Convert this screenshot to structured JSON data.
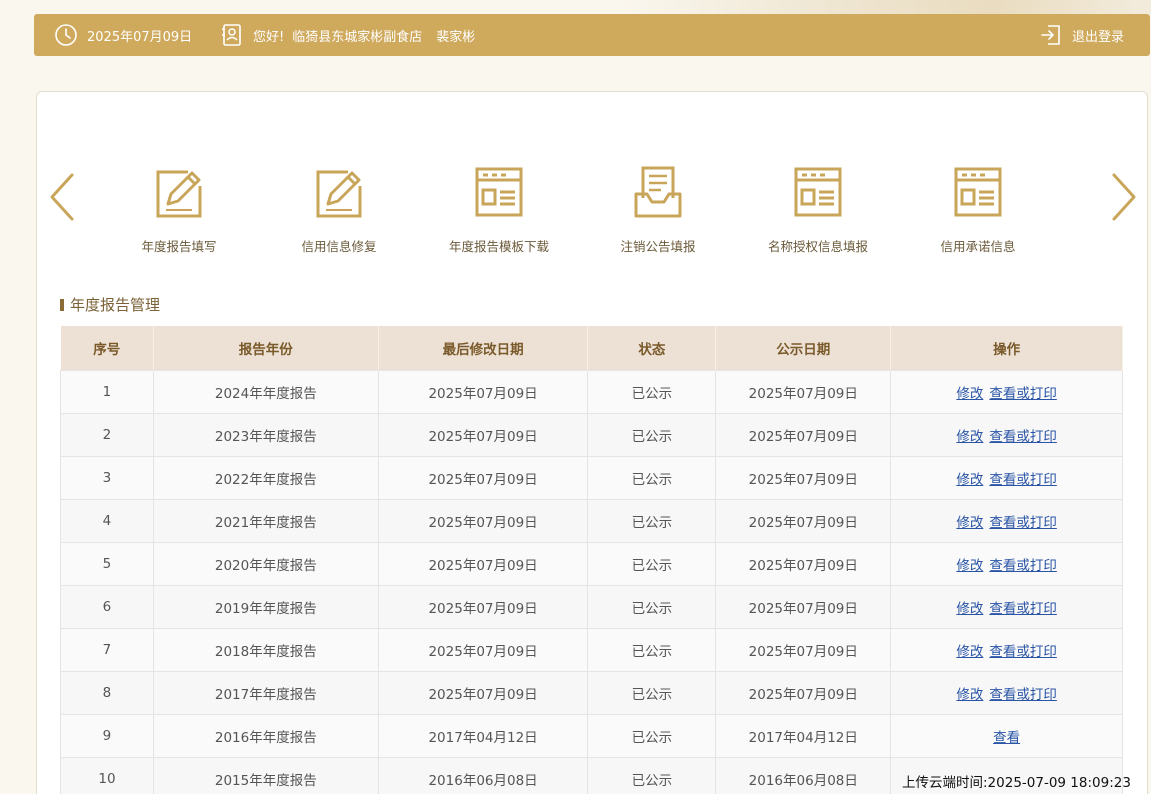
{
  "header": {
    "date": "2025年07月09日",
    "greeting": "您好!",
    "store_name": "临猗县东城家彬副食店",
    "user_name": "裴家彬",
    "logout_label": "退出登录"
  },
  "shortcuts": [
    {
      "label": "年度报告填写",
      "icon": "edit-form-icon"
    },
    {
      "label": "信用信息修复",
      "icon": "edit-form-icon"
    },
    {
      "label": "年度报告模板下载",
      "icon": "template-window-icon"
    },
    {
      "label": "注销公告填报",
      "icon": "inbox-document-icon"
    },
    {
      "label": "名称授权信息填报",
      "icon": "template-window-icon"
    },
    {
      "label": "信用承诺信息",
      "icon": "template-window-icon"
    }
  ],
  "section_title": "年度报告管理",
  "table": {
    "headers": [
      "序号",
      "报告年份",
      "最后修改日期",
      "状态",
      "公示日期",
      "操作"
    ],
    "rows": [
      {
        "no": "1",
        "year": "2024年年度报告",
        "modified": "2025年07月09日",
        "status": "已公示",
        "published": "2025年07月09日",
        "ops": [
          "修改",
          "查看或打印"
        ]
      },
      {
        "no": "2",
        "year": "2023年年度报告",
        "modified": "2025年07月09日",
        "status": "已公示",
        "published": "2025年07月09日",
        "ops": [
          "修改",
          "查看或打印"
        ]
      },
      {
        "no": "3",
        "year": "2022年年度报告",
        "modified": "2025年07月09日",
        "status": "已公示",
        "published": "2025年07月09日",
        "ops": [
          "修改",
          "查看或打印"
        ]
      },
      {
        "no": "4",
        "year": "2021年年度报告",
        "modified": "2025年07月09日",
        "status": "已公示",
        "published": "2025年07月09日",
        "ops": [
          "修改",
          "查看或打印"
        ]
      },
      {
        "no": "5",
        "year": "2020年年度报告",
        "modified": "2025年07月09日",
        "status": "已公示",
        "published": "2025年07月09日",
        "ops": [
          "修改",
          "查看或打印"
        ]
      },
      {
        "no": "6",
        "year": "2019年年度报告",
        "modified": "2025年07月09日",
        "status": "已公示",
        "published": "2025年07月09日",
        "ops": [
          "修改",
          "查看或打印"
        ]
      },
      {
        "no": "7",
        "year": "2018年年度报告",
        "modified": "2025年07月09日",
        "status": "已公示",
        "published": "2025年07月09日",
        "ops": [
          "修改",
          "查看或打印"
        ]
      },
      {
        "no": "8",
        "year": "2017年年度报告",
        "modified": "2025年07月09日",
        "status": "已公示",
        "published": "2025年07月09日",
        "ops": [
          "修改",
          "查看或打印"
        ]
      },
      {
        "no": "9",
        "year": "2016年年度报告",
        "modified": "2017年04月12日",
        "status": "已公示",
        "published": "2017年04月12日",
        "ops": [
          "查看"
        ]
      },
      {
        "no": "10",
        "year": "2015年年度报告",
        "modified": "2016年06月08日",
        "status": "已公示",
        "published": "2016年06月08日",
        "ops": []
      }
    ]
  },
  "upload_time": "上传云端时间:2025-07-09 18:09:23",
  "colors": {
    "accent": "#cfa95c",
    "icon": "#c9a55a",
    "link": "#2a55a6",
    "table_header": "#ece1d4"
  }
}
